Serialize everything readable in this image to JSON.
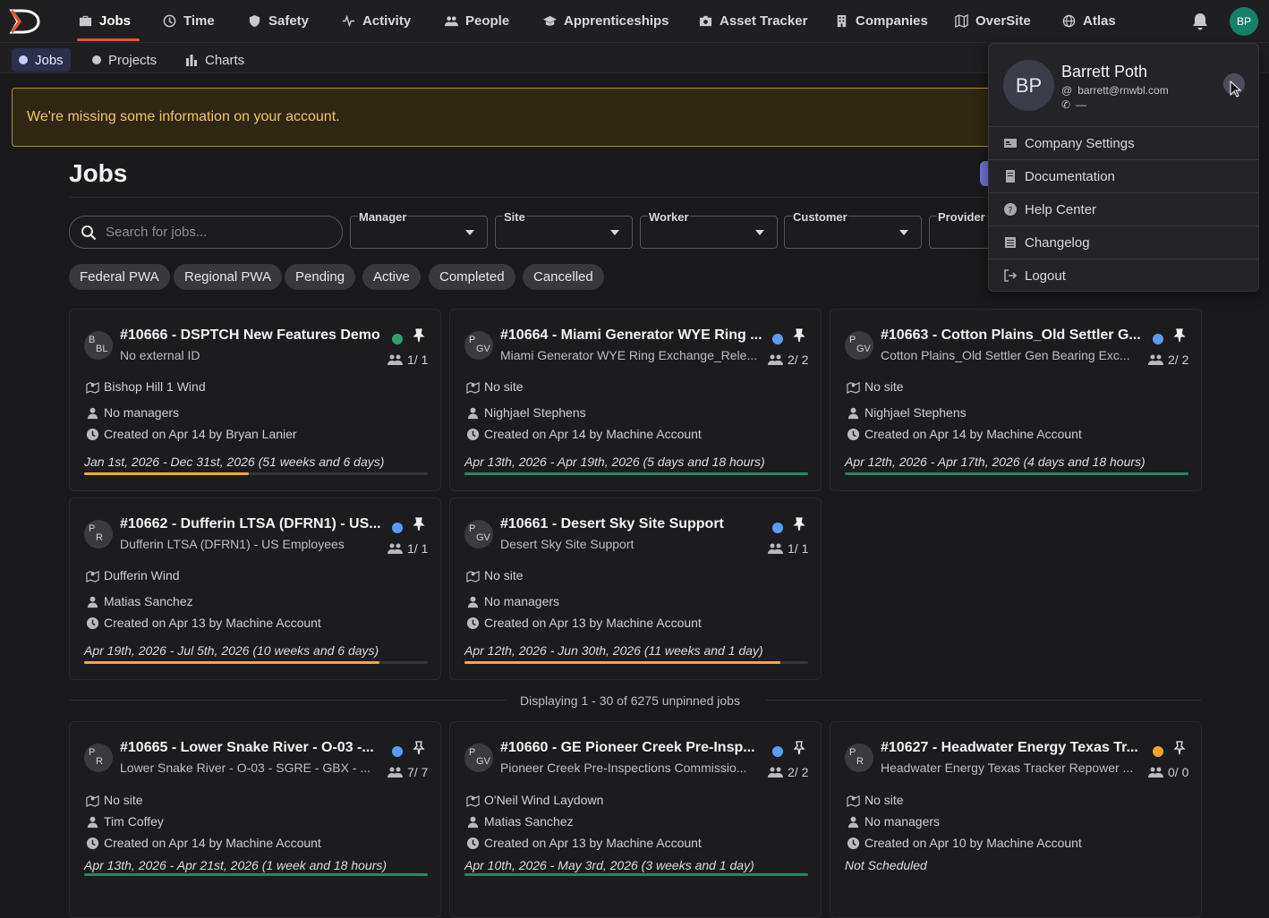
{
  "nav": {
    "items": [
      {
        "label": "Jobs"
      },
      {
        "label": "Time"
      },
      {
        "label": "Safety"
      },
      {
        "label": "Activity"
      },
      {
        "label": "People"
      },
      {
        "label": "Apprenticeships"
      },
      {
        "label": "Asset Tracker"
      },
      {
        "label": "Companies"
      },
      {
        "label": "OverSite"
      },
      {
        "label": "Atlas"
      }
    ],
    "active": "Jobs",
    "avatar_initials": "BP"
  },
  "subnav": {
    "items": [
      {
        "label": "Jobs"
      },
      {
        "label": "Projects"
      },
      {
        "label": "Charts"
      }
    ],
    "active": "Jobs"
  },
  "alert": {
    "text": "We're missing some information on your account."
  },
  "page": {
    "title": "Jobs"
  },
  "filters": {
    "search_placeholder": "Search for jobs...",
    "selects": [
      {
        "label": "Manager"
      },
      {
        "label": "Site"
      },
      {
        "label": "Worker"
      },
      {
        "label": "Customer"
      },
      {
        "label": "Provider"
      }
    ],
    "chips": [
      "Federal PWA",
      "Regional PWA",
      "Pending",
      "Active",
      "Completed",
      "Cancelled"
    ]
  },
  "pinned_jobs": [
    {
      "avatar": [
        "B",
        "BL"
      ],
      "title": "#10666 - DSPTCH New Features Demo",
      "subtitle": "No external ID",
      "status": "green",
      "workers": "1/ 1",
      "site": "Bishop Hill 1 Wind",
      "managers": "No managers",
      "created": "Created on Apr 14 by Bryan Lanier",
      "dates": "Jan 1st, 2026 - Dec 31st, 2026 (51 weeks and 6 days)",
      "progress": 0.48,
      "progress_color": "#f2a93b"
    },
    {
      "avatar": [
        "P",
        "GV"
      ],
      "title": "#10664 - Miami Generator WYE Ring ...",
      "subtitle": "Miami Generator WYE Ring Exchange_Rele...",
      "status": "blue",
      "workers": "2/ 2",
      "site": "No site",
      "managers": "Nighjael Stephens",
      "created": "Created on Apr 14 by Machine Account",
      "dates": "Apr 13th, 2026 - Apr 19th, 2026 (5 days and 18 hours)",
      "progress": 1,
      "progress_color": "#1f8a63"
    },
    {
      "avatar": [
        "P",
        "GV"
      ],
      "title": "#10663 - Cotton Plains_Old Settler G...",
      "subtitle": "Cotton Plains_Old Settler Gen Bearing Exc...",
      "status": "blue",
      "workers": "2/ 2",
      "site": "No site",
      "managers": "Nighjael Stephens",
      "created": "Created on Apr 14 by Machine Account",
      "dates": "Apr 12th, 2026 - Apr 17th, 2026 (4 days and 18 hours)",
      "progress": 1,
      "progress_color": "#1f8a63"
    },
    {
      "avatar": [
        "P",
        "R"
      ],
      "title": "#10662 - Dufferin LTSA (DFRN1) - US...",
      "subtitle": "Dufferin LTSA (DFRN1) - US Employees",
      "status": "blue",
      "workers": "1/ 1",
      "site": "Dufferin Wind",
      "managers": "Matias Sanchez",
      "created": "Created on Apr 13 by Machine Account",
      "dates": "Apr 19th, 2026 - Jul 5th, 2026 (10 weeks and 6 days)",
      "progress": 0.86,
      "progress_color": "#f2a93b"
    },
    {
      "avatar": [
        "P",
        "GV"
      ],
      "title": "#10661 - Desert Sky Site Support",
      "subtitle": "Desert Sky Site Support",
      "status": "blue",
      "workers": "1/ 1",
      "site": "No site",
      "managers": "No managers",
      "created": "Created on Apr 13 by Machine Account",
      "dates": "Apr 12th, 2026 - Jun 30th, 2026 (11 weeks and 1 day)",
      "progress": 0.92,
      "progress_color": "#f2a93b"
    }
  ],
  "display_text": "Displaying 1 - 30 of 6275 unpinned jobs",
  "unpinned_jobs": [
    {
      "avatar": [
        "P",
        "R"
      ],
      "title": "#10665 - Lower Snake River - O-03 -...",
      "subtitle": "Lower Snake River - O-03 - SGRE - GBX - ...",
      "status": "blue",
      "workers": "7/ 7",
      "site": "No site",
      "managers": "Tim Coffey",
      "created": "Created on Apr 14 by Machine Account",
      "dates": "Apr 13th, 2026 - Apr 21st, 2026 (1 week and 18 hours)",
      "progress": 1,
      "progress_color": "#1f8a63"
    },
    {
      "avatar": [
        "P",
        "GV"
      ],
      "title": "#10660 - GE Pioneer Creek Pre-Insp...",
      "subtitle": "Pioneer Creek Pre-Inspections Commissio...",
      "status": "blue",
      "workers": "2/ 2",
      "site": "O'Neil Wind Laydown",
      "managers": "Matias Sanchez",
      "created": "Created on Apr 13 by Machine Account",
      "dates": "Apr 10th, 2026 - May 3rd, 2026 (3 weeks and 1 day)",
      "progress": 1,
      "progress_color": "#1f8a63"
    },
    {
      "avatar": [
        "P",
        "R"
      ],
      "title": "#10627 - Headwater Energy Texas Tr...",
      "subtitle": "Headwater Energy Texas Tracker Repower ...",
      "status": "orange",
      "workers": "0/ 0",
      "site": "No site",
      "managers": "No managers",
      "created": "Created on Apr 10 by Machine Account",
      "dates": "Not Scheduled",
      "progress": null,
      "progress_color": ""
    }
  ],
  "colors": {
    "green": "#2e9e6a",
    "blue": "#5b9cf0",
    "orange": "#f5a623",
    "accent": "#e0533a"
  },
  "user_menu": {
    "initials": "BP",
    "name": "Barrett Poth",
    "email": "barrett@rnwbl.com",
    "phone": "—",
    "items": [
      {
        "label": "Company Settings",
        "icon": "id-card-icon"
      },
      {
        "label": "Documentation",
        "icon": "book-icon"
      },
      {
        "label": "Help Center",
        "icon": "question-icon"
      },
      {
        "label": "Changelog",
        "icon": "list-icon"
      },
      {
        "label": "Logout",
        "icon": "logout-icon"
      }
    ]
  }
}
